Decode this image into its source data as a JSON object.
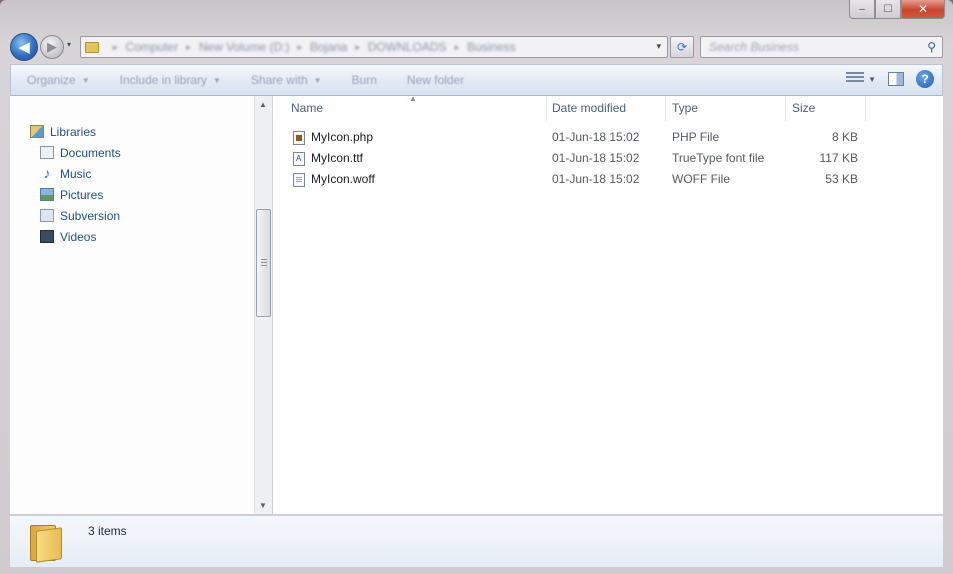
{
  "window": {
    "caption_buttons": {
      "minimize": "–",
      "maximize": "☐",
      "close": "✕"
    }
  },
  "nav": {
    "back_icon": "◀",
    "forward_icon": "▶",
    "recent_icon": "▾",
    "breadcrumbs": [
      "Computer",
      "New Volume (D:)",
      "Bojana",
      "DOWNLOADS",
      "Business"
    ],
    "breadcrumb_separator": "▸",
    "address_dropdown": "▾",
    "refresh_icon": "⟳",
    "search_placeholder": "Search Business",
    "search_icon": "⚲"
  },
  "toolbar": {
    "organize": "Organize",
    "include_in_library": "Include in library",
    "share_with": "Share with",
    "burn": "Burn",
    "new_folder": "New folder",
    "dropdown_arrow": "▼",
    "help": "?"
  },
  "sidebar": {
    "items": [
      {
        "label": "Libraries",
        "icon": "libraries-icon",
        "level": 0
      },
      {
        "label": "Documents",
        "icon": "documents-icon",
        "level": 1
      },
      {
        "label": "Music",
        "icon": "music-icon",
        "level": 1
      },
      {
        "label": "Pictures",
        "icon": "pictures-icon",
        "level": 1
      },
      {
        "label": "Subversion",
        "icon": "subversion-icon",
        "level": 1
      },
      {
        "label": "Videos",
        "icon": "videos-icon",
        "level": 1
      }
    ],
    "music_glyph": "♪",
    "scroll_up": "▲",
    "scroll_down": "▼"
  },
  "file_list": {
    "columns": {
      "name": "Name",
      "date": "Date modified",
      "type": "Type",
      "size": "Size"
    },
    "sort_indicator": "▲",
    "rows": [
      {
        "name": "MyIcon.php",
        "date": "01-Jun-18 15:02",
        "type": "PHP File",
        "size": "8 KB",
        "icon": "php-file-icon"
      },
      {
        "name": "MyIcon.ttf",
        "date": "01-Jun-18 15:02",
        "type": "TrueType font file",
        "size": "117 KB",
        "icon": "ttf-file-icon"
      },
      {
        "name": "MyIcon.woff",
        "date": "01-Jun-18 15:02",
        "type": "WOFF File",
        "size": "53 KB",
        "icon": "woff-file-icon"
      }
    ]
  },
  "status": {
    "item_count": "3 items",
    "icon": "folder-icon"
  },
  "colors": {
    "accent": "#1f4f86",
    "toolbar_bg": "#e4ebf5",
    "close_button": "#c8442c"
  }
}
